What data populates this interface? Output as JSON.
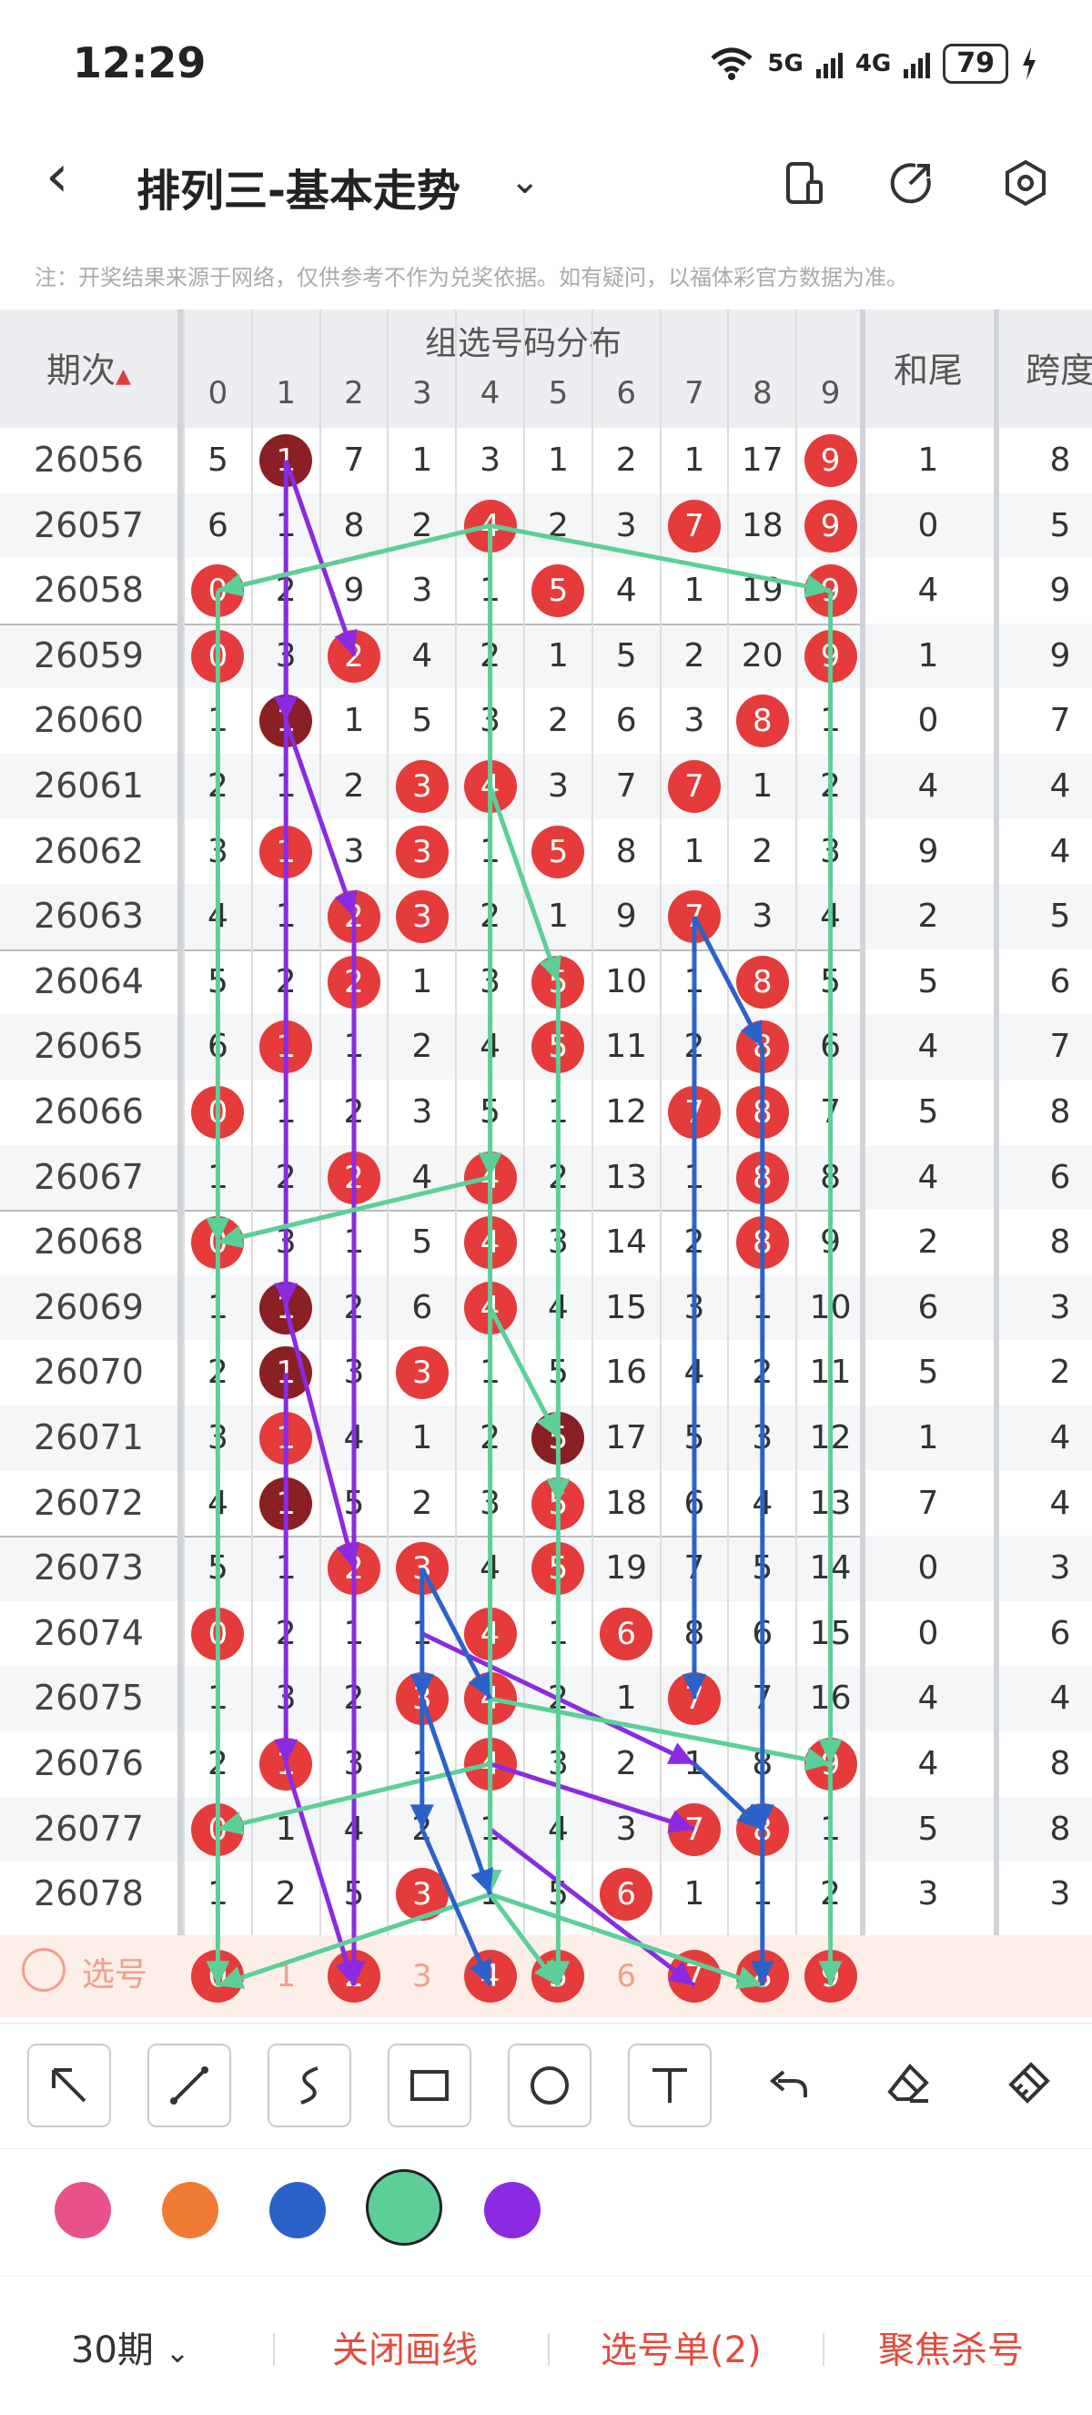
{
  "status_bar": {
    "time": "12:29",
    "network1": "5G",
    "network2": "4G",
    "battery": "79"
  },
  "header": {
    "title": "排列三-基本走势"
  },
  "notice": "注：开奖结果来源于网络，仅供参考不作为兑奖依据。如有疑问，以福体彩官方数据为准。",
  "table": {
    "period_header": "期次",
    "group_header": "组选号码分布",
    "digits": [
      "0",
      "1",
      "2",
      "3",
      "4",
      "5",
      "6",
      "7",
      "8",
      "9"
    ],
    "sum_tail_header": "和尾",
    "span_header": "跨度",
    "rows": [
      {
        "period": "26056",
        "cells": [
          "5",
          "1",
          "7",
          "1",
          "3",
          "1",
          "2",
          "1",
          "17",
          "9"
        ],
        "hit": [
          1,
          9
        ],
        "dark": [
          1
        ],
        "sum": "1",
        "span": "8"
      },
      {
        "period": "26057",
        "cells": [
          "6",
          "1",
          "8",
          "2",
          "4",
          "2",
          "3",
          "7",
          "18",
          "9"
        ],
        "hit": [
          4,
          7,
          9
        ],
        "dark": [],
        "sum": "0",
        "span": "5"
      },
      {
        "period": "26058",
        "cells": [
          "0",
          "2",
          "9",
          "3",
          "1",
          "5",
          "4",
          "1",
          "19",
          "9"
        ],
        "hit": [
          0,
          5,
          9
        ],
        "dark": [],
        "sum": "4",
        "span": "9"
      },
      {
        "period": "26059",
        "cells": [
          "0",
          "3",
          "2",
          "4",
          "2",
          "1",
          "5",
          "2",
          "20",
          "9"
        ],
        "hit": [
          0,
          2,
          9
        ],
        "dark": [],
        "sum": "1",
        "span": "9"
      },
      {
        "period": "26060",
        "cells": [
          "1",
          "1",
          "1",
          "5",
          "3",
          "2",
          "6",
          "3",
          "8",
          "1"
        ],
        "hit": [
          1,
          8
        ],
        "dark": [
          1
        ],
        "sum": "0",
        "span": "7"
      },
      {
        "period": "26061",
        "cells": [
          "2",
          "1",
          "2",
          "3",
          "4",
          "3",
          "7",
          "7",
          "1",
          "2"
        ],
        "hit": [
          3,
          4,
          7
        ],
        "dark": [],
        "sum": "4",
        "span": "4"
      },
      {
        "period": "26062",
        "cells": [
          "3",
          "1",
          "3",
          "3",
          "1",
          "5",
          "8",
          "1",
          "2",
          "3"
        ],
        "hit": [
          1,
          3,
          5
        ],
        "dark": [],
        "sum": "9",
        "span": "4"
      },
      {
        "period": "26063",
        "cells": [
          "4",
          "1",
          "2",
          "3",
          "2",
          "1",
          "9",
          "7",
          "3",
          "4"
        ],
        "hit": [
          2,
          3,
          7
        ],
        "dark": [],
        "sum": "2",
        "span": "5"
      },
      {
        "period": "26064",
        "cells": [
          "5",
          "2",
          "2",
          "1",
          "3",
          "5",
          "10",
          "1",
          "8",
          "5"
        ],
        "hit": [
          2,
          5,
          8
        ],
        "dark": [],
        "sum": "5",
        "span": "6"
      },
      {
        "period": "26065",
        "cells": [
          "6",
          "1",
          "1",
          "2",
          "4",
          "5",
          "11",
          "2",
          "8",
          "6"
        ],
        "hit": [
          1,
          5,
          8
        ],
        "dark": [],
        "sum": "4",
        "span": "7"
      },
      {
        "period": "26066",
        "cells": [
          "0",
          "1",
          "2",
          "3",
          "5",
          "1",
          "12",
          "7",
          "8",
          "7"
        ],
        "hit": [
          0,
          7,
          8
        ],
        "dark": [],
        "sum": "5",
        "span": "8"
      },
      {
        "period": "26067",
        "cells": [
          "1",
          "2",
          "2",
          "4",
          "4",
          "2",
          "13",
          "1",
          "8",
          "8"
        ],
        "hit": [
          2,
          4,
          8
        ],
        "dark": [],
        "sum": "4",
        "span": "6"
      },
      {
        "period": "26068",
        "cells": [
          "0",
          "3",
          "1",
          "5",
          "4",
          "3",
          "14",
          "2",
          "8",
          "9"
        ],
        "hit": [
          0,
          4,
          8
        ],
        "dark": [],
        "sum": "2",
        "span": "8"
      },
      {
        "period": "26069",
        "cells": [
          "1",
          "1",
          "2",
          "6",
          "4",
          "4",
          "15",
          "3",
          "1",
          "10"
        ],
        "hit": [
          1,
          4
        ],
        "dark": [
          1
        ],
        "sum": "6",
        "span": "3"
      },
      {
        "period": "26070",
        "cells": [
          "2",
          "1",
          "3",
          "3",
          "1",
          "5",
          "16",
          "4",
          "2",
          "11"
        ],
        "hit": [
          1,
          3
        ],
        "dark": [
          1
        ],
        "sum": "5",
        "span": "2"
      },
      {
        "period": "26071",
        "cells": [
          "3",
          "1",
          "4",
          "1",
          "2",
          "5",
          "17",
          "5",
          "3",
          "12"
        ],
        "hit": [
          1,
          5
        ],
        "dark": [
          5
        ],
        "sum": "1",
        "span": "4"
      },
      {
        "period": "26072",
        "cells": [
          "4",
          "1",
          "5",
          "2",
          "3",
          "5",
          "18",
          "6",
          "4",
          "13"
        ],
        "hit": [
          1,
          5
        ],
        "dark": [
          1
        ],
        "sum": "7",
        "span": "4"
      },
      {
        "period": "26073",
        "cells": [
          "5",
          "1",
          "2",
          "3",
          "4",
          "5",
          "19",
          "7",
          "5",
          "14"
        ],
        "hit": [
          2,
          3,
          5
        ],
        "dark": [],
        "sum": "0",
        "span": "3"
      },
      {
        "period": "26074",
        "cells": [
          "0",
          "2",
          "1",
          "1",
          "4",
          "1",
          "6",
          "8",
          "6",
          "15"
        ],
        "hit": [
          0,
          4,
          6
        ],
        "dark": [],
        "sum": "0",
        "span": "6"
      },
      {
        "period": "26075",
        "cells": [
          "1",
          "3",
          "2",
          "3",
          "4",
          "2",
          "1",
          "7",
          "7",
          "16"
        ],
        "hit": [
          3,
          4,
          7
        ],
        "dark": [],
        "sum": "4",
        "span": "4"
      },
      {
        "period": "26076",
        "cells": [
          "2",
          "1",
          "3",
          "1",
          "4",
          "3",
          "2",
          "1",
          "8",
          "9"
        ],
        "hit": [
          1,
          4,
          9
        ],
        "dark": [],
        "sum": "4",
        "span": "8"
      },
      {
        "period": "26077",
        "cells": [
          "0",
          "1",
          "4",
          "2",
          "1",
          "4",
          "3",
          "7",
          "8",
          "1"
        ],
        "hit": [
          0,
          7,
          8
        ],
        "dark": [],
        "sum": "5",
        "span": "8"
      },
      {
        "period": "26078",
        "cells": [
          "1",
          "2",
          "5",
          "3",
          "1",
          "5",
          "6",
          "1",
          "1",
          "2"
        ],
        "hit": [
          3,
          6
        ],
        "dark": [],
        "sum": "3",
        "span": "3"
      }
    ],
    "select_row": {
      "label": "选号",
      "picked": [
        "0",
        "1",
        "2",
        "3",
        "4",
        "5",
        "6",
        "7",
        "8",
        "9"
      ],
      "hit": [
        0,
        2,
        4,
        5,
        7,
        8,
        9
      ]
    }
  },
  "toolbar": {
    "tools": [
      "arrow-tool",
      "line-tool",
      "curve-tool",
      "rect-tool",
      "circle-tool",
      "text-tool",
      "undo-tool",
      "eraser-tool",
      "clear-tool"
    ]
  },
  "colors": {
    "pink": "#e8528a",
    "orange": "#ef7c32",
    "blue": "#2a62c9",
    "green": "#5ccf98",
    "purple": "#8a2be2",
    "selected": "green"
  },
  "bottom": {
    "period_select": "30期",
    "close_draw": "关闭画线",
    "pick_list": "选号单(2)",
    "focus_kill": "聚焦杀号"
  }
}
